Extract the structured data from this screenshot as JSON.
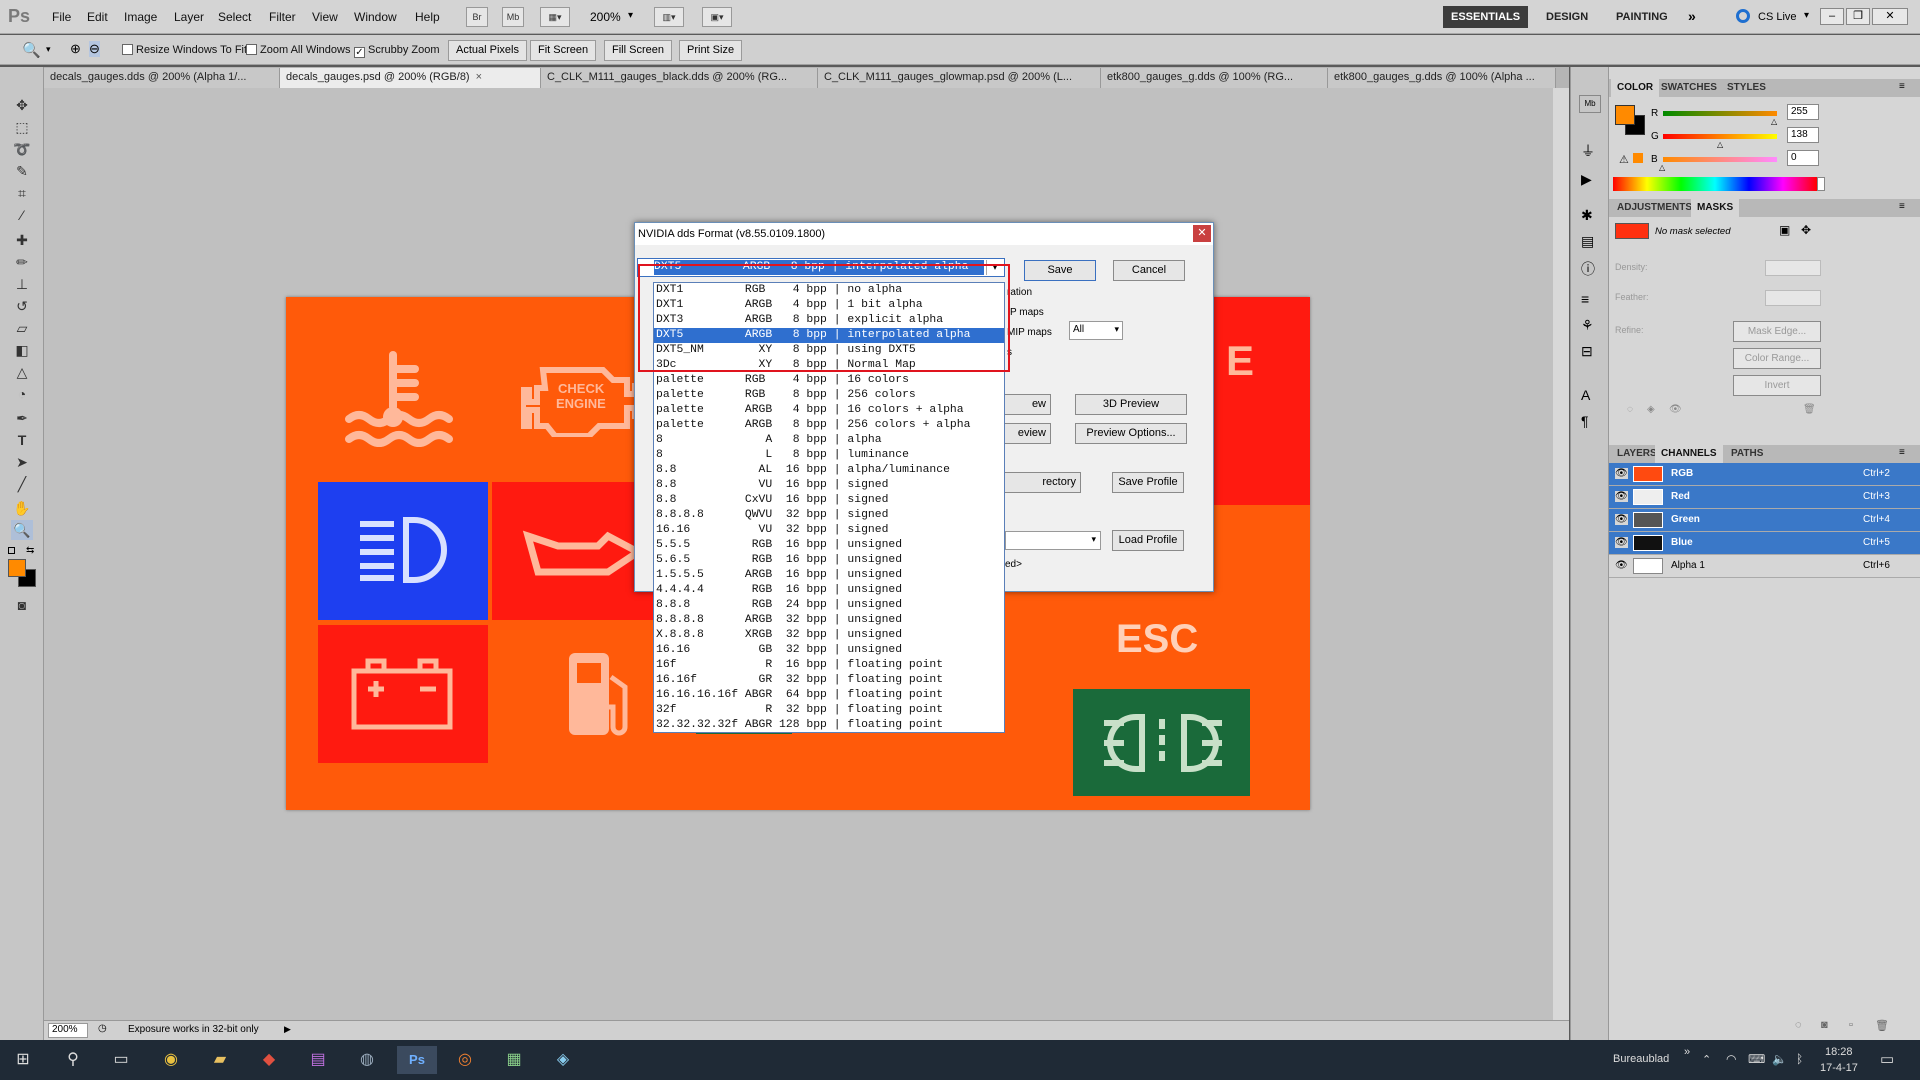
{
  "app": {
    "logo": "Ps",
    "menu": [
      "File",
      "Edit",
      "Image",
      "Layer",
      "Select",
      "Filter",
      "View",
      "Window",
      "Help"
    ],
    "zoom_level": "200%",
    "workspaces": [
      "ESSENTIALS",
      "DESIGN",
      "PAINTING"
    ],
    "active_workspace": "ESSENTIALS",
    "cs_live": "CS Live"
  },
  "options_bar": {
    "resize_windows": "Resize Windows To Fit",
    "zoom_all": "Zoom All Windows",
    "scrubby_zoom": "Scrubby Zoom",
    "buttons": [
      "Actual Pixels",
      "Fit Screen",
      "Fill Screen",
      "Print Size"
    ]
  },
  "tabs": [
    {
      "label": "decals_gauges.dds @ 200% (Alpha 1/...",
      "active": false
    },
    {
      "label": "decals_gauges.psd @ 200% (RGB/8)",
      "active": true
    },
    {
      "label": "C_CLK_M111_gauges_black.dds @ 200% (RG...",
      "active": false
    },
    {
      "label": "C_CLK_M111_gauges_glowmap.psd @ 200% (L...",
      "active": false
    },
    {
      "label": "etk800_gauges_g.dds @ 100% (RG...",
      "active": false
    },
    {
      "label": "etk800_gauges_g.dds @ 100% (Alpha ...",
      "active": false
    }
  ],
  "canvas": {
    "check_engine_line1": "CHECK",
    "check_engine_line2": "ENGINE",
    "esc_label": "ESC",
    "partial_label": "E"
  },
  "status": {
    "zoom": "200%",
    "message": "Exposure works in 32-bit only"
  },
  "dialog": {
    "title": "NVIDIA dds Format (v8.55.0109.1800)",
    "selected_format": "DXT5         ARGB   8 bpp | interpolated alpha",
    "save": "Save",
    "cancel": "Cancel",
    "generation_frag": "ration",
    "mip_frag": "P maps",
    "use_mip_frag": "MIP maps",
    "mip_select": "All",
    "s_frag": "s",
    "preview_frag": "ew",
    "preview2_frag": "eview",
    "three_d_preview": "3D Preview",
    "preview_options": "Preview Options...",
    "directory_frag": "rectory",
    "save_profile": "Save Profile",
    "load_profile": "Load Profile",
    "ed_frag": "ed>",
    "formats": [
      "DXT1         RGB    4 bpp | no alpha",
      "DXT1         ARGB   4 bpp | 1 bit alpha",
      "DXT3         ARGB   8 bpp | explicit alpha",
      "DXT5         ARGB   8 bpp | interpolated alpha",
      "DXT5_NM        XY   8 bpp | using DXT5",
      "3Dc            XY   8 bpp | Normal Map",
      "palette      RGB    4 bpp | 16 colors",
      "palette      RGB    8 bpp | 256 colors",
      "palette      ARGB   4 bpp | 16 colors + alpha",
      "palette      ARGB   8 bpp | 256 colors + alpha",
      "8               A   8 bpp | alpha",
      "8               L   8 bpp | luminance",
      "8.8            AL  16 bpp | alpha/luminance",
      "8.8            VU  16 bpp | signed",
      "8.8          CxVU  16 bpp | signed",
      "8.8.8.8      QWVU  32 bpp | signed",
      "16.16          VU  32 bpp | signed",
      "5.5.5         RGB  16 bpp | unsigned",
      "5.6.5         RGB  16 bpp | unsigned",
      "1.5.5.5      ARGB  16 bpp | unsigned",
      "4.4.4.4       RGB  16 bpp | unsigned",
      "8.8.8         RGB  24 bpp | unsigned",
      "8.8.8.8      ARGB  32 bpp | unsigned",
      "X.8.8.8      XRGB  32 bpp | unsigned",
      "16.16          GB  32 bpp | unsigned",
      "16f             R  16 bpp | floating point",
      "16.16f         GR  32 bpp | floating point",
      "16.16.16.16f ABGR  64 bpp | floating point",
      "32f             R  32 bpp | floating point",
      "32.32.32.32f ABGR 128 bpp | floating point"
    ],
    "highlighted_index": 3
  },
  "color_panel": {
    "tabs": [
      "COLOR",
      "SWATCHES",
      "STYLES"
    ],
    "r_label": "R",
    "g_label": "G",
    "b_label": "B",
    "r": "255",
    "g": "138",
    "b": "0"
  },
  "masks_panel": {
    "tabs": [
      "ADJUSTMENTS",
      "MASKS"
    ],
    "no_mask": "No mask selected",
    "density": "Density:",
    "feather": "Feather:",
    "refine": "Refine:",
    "mask_edge": "Mask Edge...",
    "color_range": "Color Range...",
    "invert": "Invert"
  },
  "channels_panel": {
    "tabs": [
      "LAYERS",
      "CHANNELS",
      "PATHS"
    ],
    "channels": [
      {
        "name": "RGB",
        "shortcut": "Ctrl+2",
        "selected": true
      },
      {
        "name": "Red",
        "shortcut": "Ctrl+3",
        "selected": true
      },
      {
        "name": "Green",
        "shortcut": "Ctrl+4",
        "selected": true
      },
      {
        "name": "Blue",
        "shortcut": "Ctrl+5",
        "selected": true
      },
      {
        "name": "Alpha 1",
        "shortcut": "Ctrl+6",
        "selected": false
      }
    ]
  },
  "taskbar": {
    "desktop_label": "Bureaublad",
    "time": "18:28",
    "date": "17-4-17"
  },
  "colors": {
    "canvas_orange": "#ff5a0a",
    "red_tile": "#ff1a10",
    "blue_tile": "#1e3ff0",
    "green_tile": "#1a6a3a",
    "selection_blue": "#3a78c8"
  }
}
